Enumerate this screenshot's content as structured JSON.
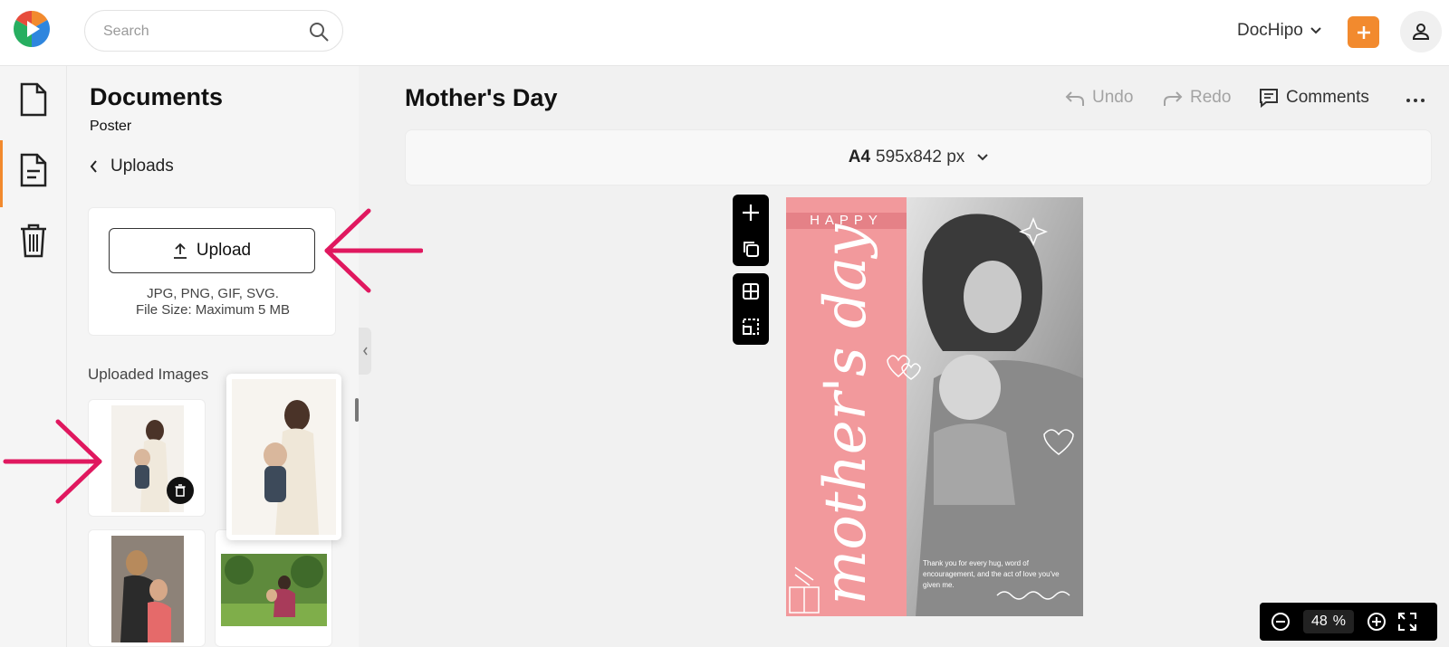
{
  "topbar": {
    "search_placeholder": "Search",
    "brand_menu_label": "DocHipo",
    "accent_color": "#f28a2e"
  },
  "rail": {
    "items": [
      {
        "icon": "document-icon",
        "active": false
      },
      {
        "icon": "template-document-icon",
        "active": true
      },
      {
        "icon": "trash-icon",
        "active": false
      }
    ]
  },
  "panel": {
    "title": "Documents",
    "subtitle": "Poster",
    "back_label": "Uploads",
    "upload_button_label": "Upload",
    "upload_hint_line1": "JPG, PNG, GIF, SVG.",
    "upload_hint_line2": "File Size: Maximum 5 MB",
    "uploaded_images_label": "Uploaded Images"
  },
  "editor": {
    "document_title": "Mother's Day",
    "undo_label": "Undo",
    "redo_label": "Redo",
    "comments_label": "Comments",
    "page_size_name": "A4",
    "page_size_dims": "595x842 px"
  },
  "canvas": {
    "happy_text": "HAPPY",
    "script_text": "mother's day",
    "caption": "Thank you for every hug, word of encouragement, and the act of love you've given me.",
    "pink_color": "#f2999c"
  },
  "zoom": {
    "value": "48",
    "unit": "%"
  }
}
